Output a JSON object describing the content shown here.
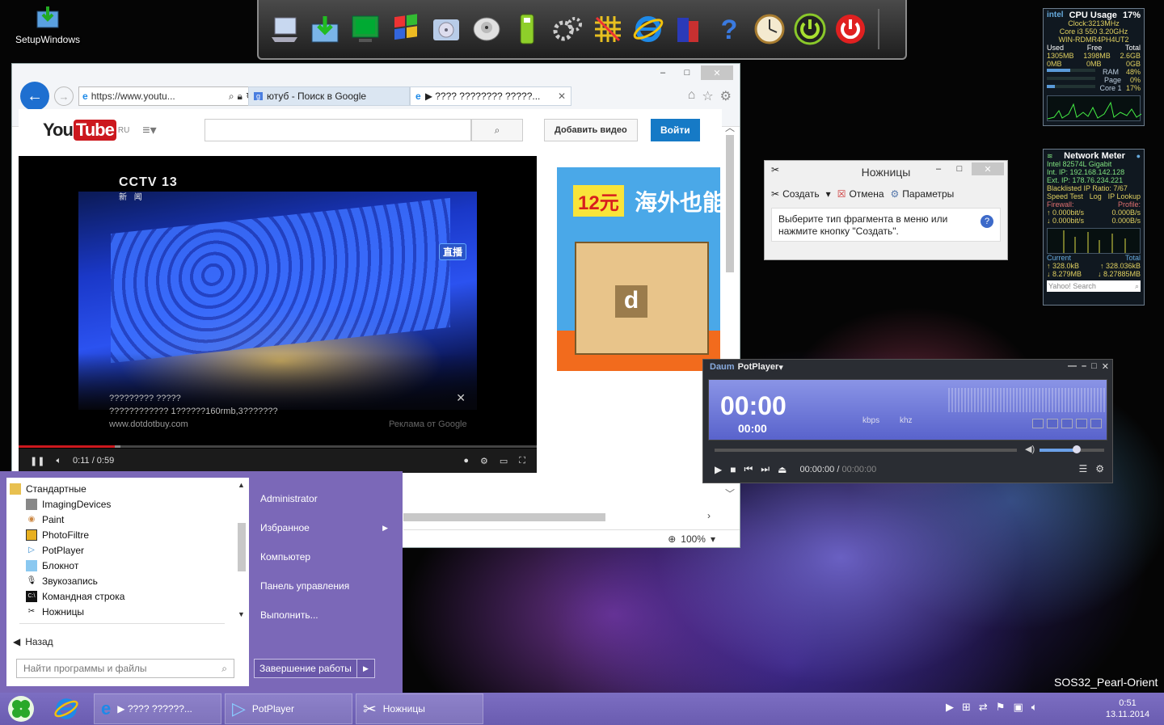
{
  "desktop": {
    "icon_label": "SetupWindows",
    "brand_tag": "SOS32_Pearl-Orient"
  },
  "dock": {
    "icons": [
      "laptop-icon",
      "download-icon",
      "monitor-icon",
      "windows-flag-icon",
      "disk-icon",
      "hard-drive-icon",
      "usb-drive-icon",
      "gears-icon",
      "network-icon",
      "ie-icon",
      "books-icon",
      "help-icon",
      "clock-icon",
      "power-green-icon",
      "power-red-icon"
    ]
  },
  "cpu_gadget": {
    "title": "CPU Usage",
    "usage": "17%",
    "clock": "Clock:3213MHz",
    "cpu": "Core i3 550 3.20GHz",
    "host": "WIN-RDMR4PH4UT2",
    "headers": [
      "Used",
      "Free",
      "Total"
    ],
    "mem_row": [
      "1305MB",
      "1398MB",
      "2.6GB"
    ],
    "page_row": [
      "0MB",
      "0MB",
      "0GB"
    ],
    "ram_label": "RAM",
    "ram_value": "48%",
    "page_label": "Page",
    "page_value": "0%",
    "core_label": "Core 1",
    "core_value": "17%",
    "ram_fraction": 0.48,
    "page_fraction": 0.0,
    "core_fraction": 0.17
  },
  "net_gadget": {
    "title": "Network Meter",
    "adapter": "Intel 82574L Gigabit",
    "int_ip": "Int. IP: 192.168.142.128",
    "ext_ip": "Ext. IP: 178.76.234.221",
    "blacklist": "Blacklisted IP Ratio: 7/67",
    "links": [
      "Speed Test",
      "Log",
      "IP Lookup"
    ],
    "firewall": "Firewall:",
    "profile": "Profile:",
    "up1": "0.000bit/s",
    "up2": "0.000B/s",
    "down1": "0.000bit/s",
    "down2": "0.000B/s",
    "current_label": "Current",
    "total_label": "Total",
    "cur_up": "328.0kB",
    "tot_up": "328.036kB",
    "cur_down": "8.279MB",
    "tot_down": "8.27885MB",
    "search_placeholder": "Yahoo! Search"
  },
  "browser": {
    "address": "https://www.youtu...",
    "tab1": "ютуб - Поиск в Google",
    "tab2": "▶ ???? ???????? ?????...",
    "yt_region": "RU",
    "upload_label": "Добавить видео",
    "login_label": "Войти",
    "zoom": "100%",
    "video": {
      "channel": "CCTV 13",
      "channel_sub": "新 闻",
      "live_badge": "直播",
      "ad_line1": "????????? ?????",
      "ad_line2": "???????????? 1??????160rmb,3???????",
      "ad_url": "www.dotdotbuy.com",
      "ad_by": "Реклама от Google",
      "time": "0:11 / 0:59",
      "progress_fraction": 0.186
    },
    "side_ad": {
      "price": "12元",
      "text": "海外也能",
      "box_letter": "d"
    }
  },
  "snip": {
    "title": "Ножницы",
    "create": "Создать",
    "cancel": "Отмена",
    "options": "Параметры",
    "message_line1": "Выберите тип фрагмента в меню или",
    "message_line2": "нажмите кнопку \"Создать\"."
  },
  "potplayer": {
    "title": "PotPlayer",
    "brand": "Daum",
    "time_big": "00:00",
    "time_small": "00:00",
    "kbps": "kbps",
    "khz": "khz",
    "position": "00:00:00",
    "duration": "00:00:00",
    "volume_fraction": 0.58
  },
  "start_menu": {
    "folder": "Стандартные",
    "programs": [
      "ImagingDevices",
      "Paint",
      "PhotoFiltre",
      "PotPlayer",
      "Блокнот",
      "Звукозапись",
      "Командная строка",
      "Ножницы"
    ],
    "back": "Назад",
    "search_placeholder": "Найти программы и файлы",
    "right_items": [
      "Administrator",
      "Избранное",
      "Компьютер",
      "Панель управления",
      "Выполнить..."
    ],
    "shutdown": "Завершение работы"
  },
  "taskbar": {
    "btn1": "▶ ???? ??????...",
    "btn2": "PotPlayer",
    "btn3": "Ножницы",
    "time": "0:51",
    "date": "13.11.2014"
  },
  "colors": {
    "yt_red": "#cc181e",
    "yt_blue": "#167ac6",
    "start_purple": "#7b68b8",
    "ie_blue": "#1e6fd0"
  }
}
